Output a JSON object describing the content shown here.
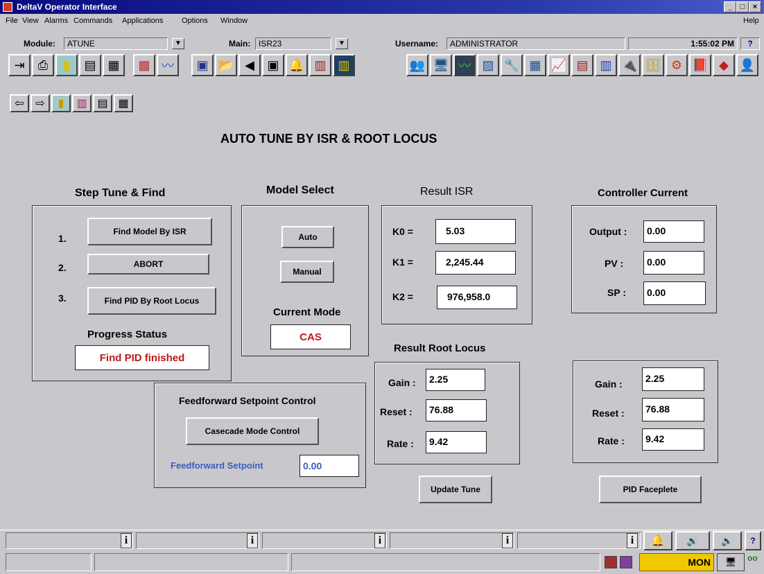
{
  "window": {
    "title": "DeltaV Operator Interface",
    "controls": [
      "_",
      "□",
      "×"
    ]
  },
  "menu": {
    "items": [
      "File",
      "View",
      "Alarms",
      "Commands",
      "Applications",
      "Options",
      "Window"
    ],
    "help": "Help"
  },
  "toolbar": {
    "module_label": "Module:",
    "module_value": "ATUNE",
    "main_label": "Main:",
    "main_value": "ISR23",
    "username_label": "Username:",
    "username_value": "ADMINISTRATOR",
    "time": "1:55:02 PM",
    "help_q": "?"
  },
  "page": {
    "title": "AUTO TUNE BY ISR & ROOT LOCUS"
  },
  "step_tune": {
    "heading": "Step Tune & Find",
    "step1_num": "1.",
    "step1_label": "Find Model By ISR",
    "step2_num": "2.",
    "step2_label": "ABORT",
    "step3_num": "3.",
    "step3_label": "Find PID By Root Locus",
    "progress_label": "Progress Status",
    "progress_value": "Find PID finished"
  },
  "model_select": {
    "heading": "Model Select",
    "auto_label": "Auto",
    "manual_label": "Manual",
    "current_mode_label": "Current Mode",
    "current_mode_value": "CAS"
  },
  "result_isr": {
    "heading": "Result ISR",
    "k0_label": "K0  =",
    "k0_value": "5.03",
    "k1_label": "K1  =",
    "k1_value": "2,245.44",
    "k2_label": "K2  =",
    "k2_value": "976,958.0"
  },
  "controller_current": {
    "heading": "Controller Current",
    "output_label": "Output :",
    "output_value": "0.00",
    "pv_label": "PV :",
    "pv_value": "0.00",
    "sp_label": "SP :",
    "sp_value": "0.00"
  },
  "root_locus": {
    "heading": "Result Root Locus",
    "gain_label": "Gain :",
    "gain_value": "2.25",
    "reset_label": "Reset :",
    "reset_value": "76.88",
    "rate_label": "Rate :",
    "rate_value": "9.42",
    "update_label": "Update Tune"
  },
  "controller_tuning": {
    "gain_label": "Gain :",
    "gain_value": "2.25",
    "reset_label": "Reset :",
    "reset_value": "76.88",
    "rate_label": "Rate :",
    "rate_value": "9.42",
    "faceplate_label": "PID Faceplete"
  },
  "feedforward": {
    "heading": "Feedforward Setpoint Control",
    "cascade_label": "Casecade Mode Control",
    "setpoint_label": "Feedforward Setpoint",
    "setpoint_value": "0.00"
  },
  "statusbar": {
    "info_glyph": "i",
    "mode_text": "MON",
    "help_q": "?",
    "dots": "oo"
  },
  "colors": {
    "background": "#c8c8cc",
    "status_red": "#c01818",
    "setpoint_blue": "#3a5cc0",
    "titlebar": "#0a0a80",
    "mon_yellow": "#f0c800"
  }
}
